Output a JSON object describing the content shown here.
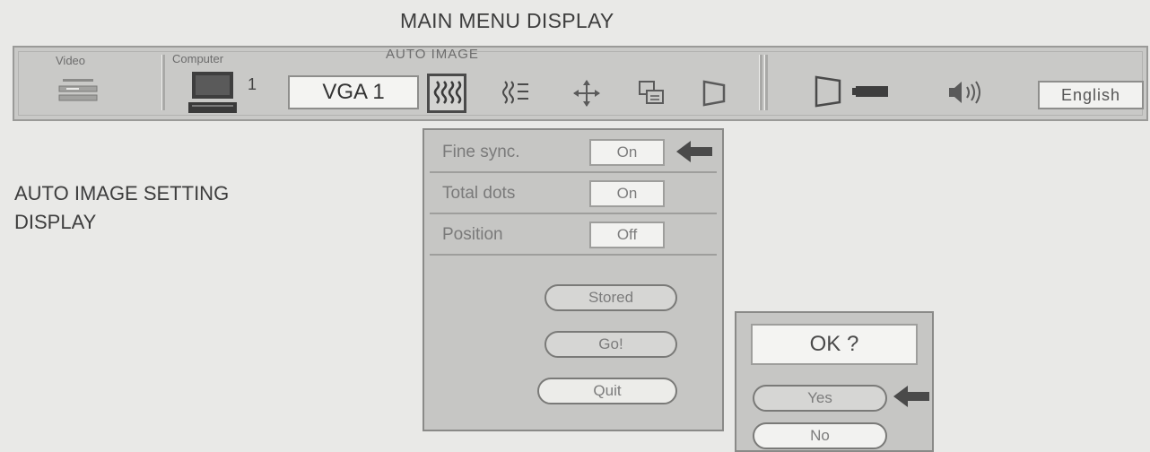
{
  "captions": {
    "main_menu": "MAIN MENU DISPLAY",
    "auto_image_setting_line1": "AUTO IMAGE SETTING",
    "auto_image_setting_line2": "DISPLAY"
  },
  "menubar": {
    "video_label": "Video",
    "computer_label": "Computer",
    "computer_number": "1",
    "auto_image_label": "AUTO IMAGE",
    "input_source": "VGA 1",
    "language": "English",
    "icons": [
      "video-deck-icon",
      "computer-icon",
      "auto-image-icon",
      "image-adjust-icon",
      "position-icon",
      "pc-adjust-icon",
      "keystone-icon",
      "projector-icon",
      "sound-icon"
    ]
  },
  "auto_image": {
    "rows": [
      {
        "label": "Fine sync.",
        "value": "On"
      },
      {
        "label": "Total dots",
        "value": "On"
      },
      {
        "label": "Position",
        "value": "Off"
      }
    ],
    "buttons": {
      "stored": "Stored",
      "go": "Go!",
      "quit": "Quit"
    }
  },
  "confirm": {
    "prompt": "OK ?",
    "yes": "Yes",
    "no": "No"
  }
}
